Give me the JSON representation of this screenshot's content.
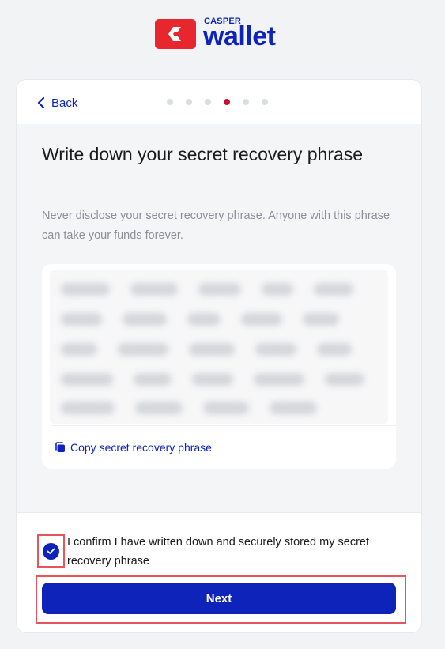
{
  "logo": {
    "brand": "CASPER",
    "product": "wallet"
  },
  "header": {
    "back_label": "Back",
    "steps_total": 6,
    "current_step": 4
  },
  "main": {
    "title": "Write down your secret recovery phrase",
    "subtitle": "Never disclose your secret recovery phrase. Anyone with this phrase can take your funds forever.",
    "copy_label": "Copy secret recovery phrase"
  },
  "footer": {
    "confirm_label": "I confirm I have written down and securely stored my secret recovery phrase",
    "confirm_checked": true,
    "next_label": "Next"
  },
  "colors": {
    "accent": "#0e23b9",
    "brand_red": "#e8262e",
    "active_step": "#c8102e",
    "highlight": "#e65559"
  }
}
